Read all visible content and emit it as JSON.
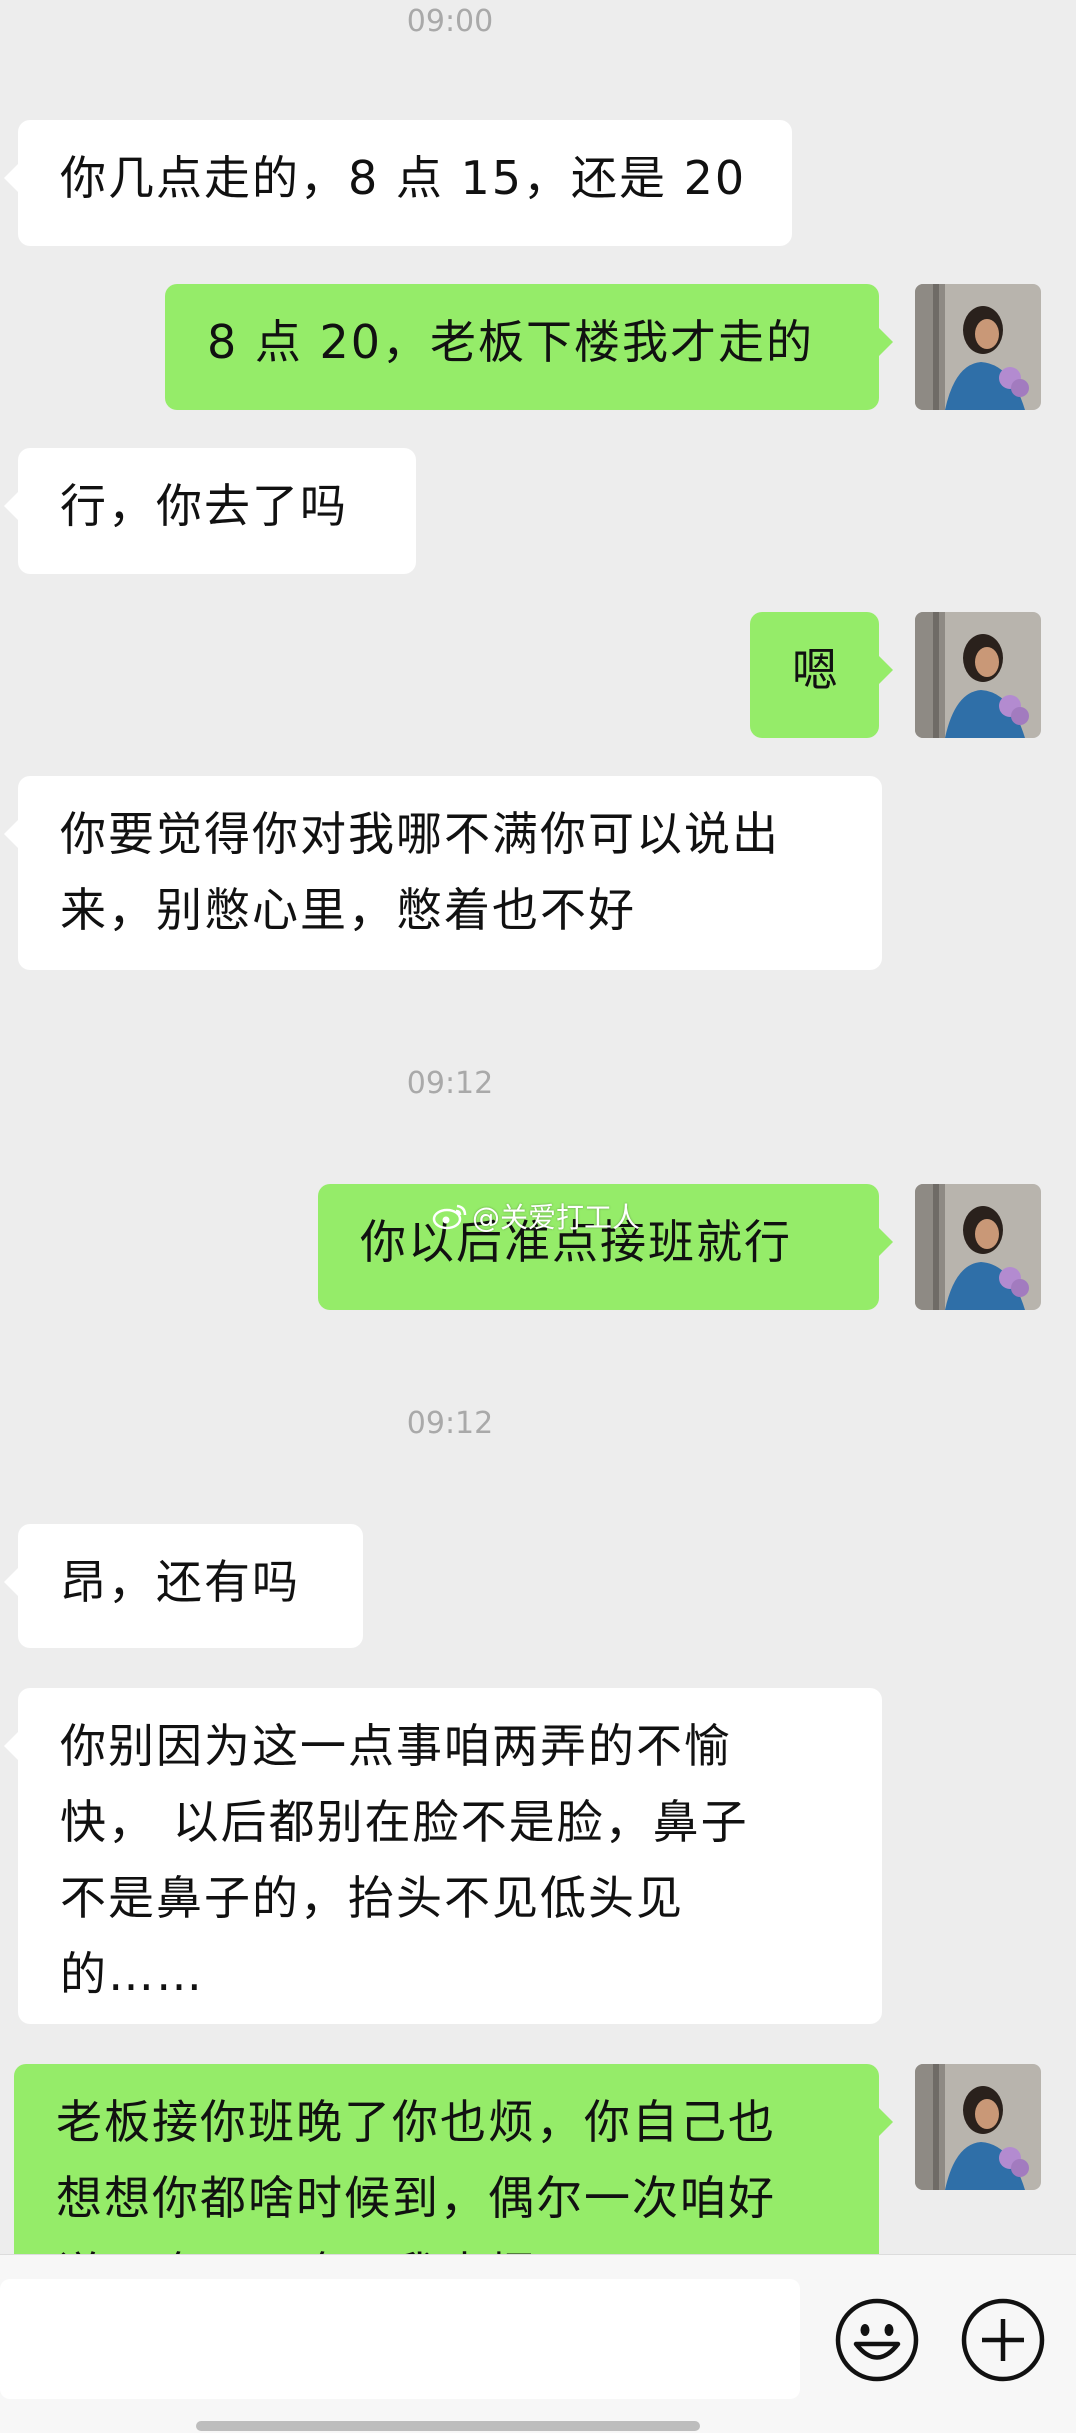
{
  "timestamps": [
    "09:00",
    "09:12",
    "09:12"
  ],
  "messages": [
    {
      "side": "left",
      "text": "你几点走的，8 点 15，还是 20"
    },
    {
      "side": "right",
      "text": "8 点 20，老板下楼我才走的"
    },
    {
      "side": "left",
      "text": "行，你去了吗"
    },
    {
      "side": "right",
      "text": "嗯"
    },
    {
      "side": "left",
      "text": "你要觉得你对我哪不满你可以说出\n来，别憋心里，憋着也不好"
    },
    {
      "side": "right",
      "text": "你以后准点接班就行"
    },
    {
      "side": "left",
      "text": "昂，还有吗"
    },
    {
      "side": "left",
      "text": "你别因为这一点事咱两弄的不愉\n快， 以后都别在脸不是脸，鼻子\n不是鼻子的，抬头不见低头见\n的……"
    },
    {
      "side": "right",
      "text": "老板接你班晚了你也烦，你自己也\n想想你都啥时候到，偶尔一次咱好\n说，晚天天晚，我也烦"
    }
  ],
  "watermark": {
    "text": "@关爱打工人"
  },
  "input": {
    "value": ""
  },
  "icons": {
    "emoji": "emoji-icon",
    "plus": "plus-icon",
    "weibo": "weibo-icon"
  },
  "colors": {
    "background": "#ededed",
    "right_bubble": "#95ec69",
    "left_bubble": "#ffffff"
  }
}
